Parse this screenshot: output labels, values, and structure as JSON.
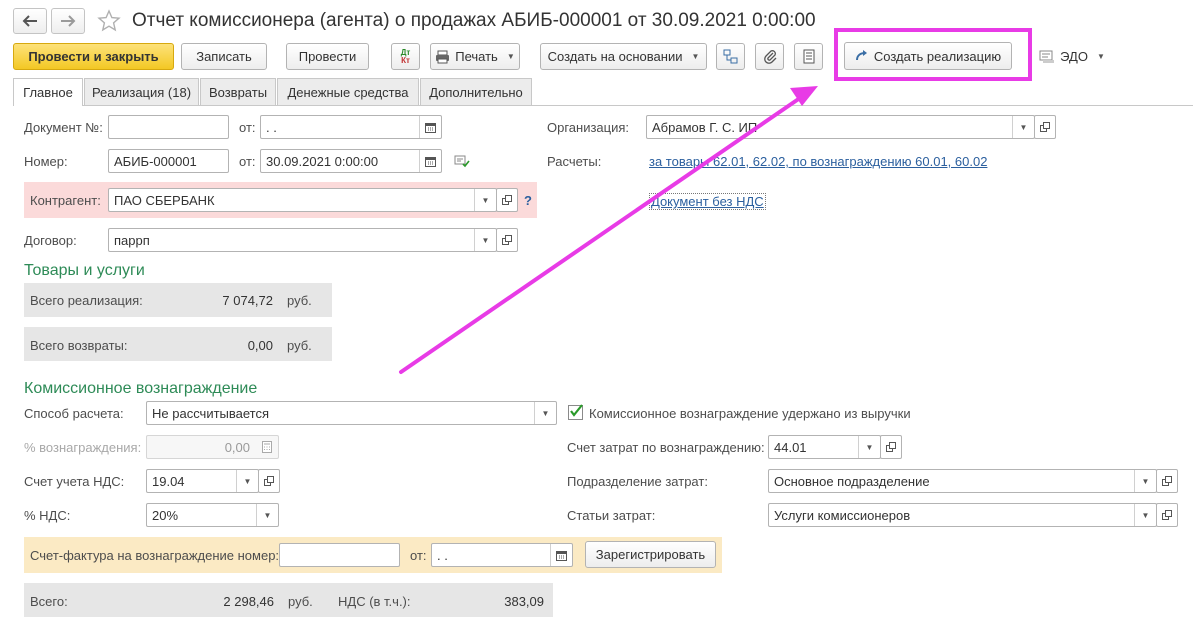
{
  "title": "Отчет комиссионера (агента) о продажах АБИБ-000001 от 30.09.2021 0:00:00",
  "toolbar": {
    "post_close": "Провести и закрыть",
    "save": "Записать",
    "post": "Провести",
    "print": "Печать",
    "create_based": "Создать на основании",
    "create_sale": "Создать реализацию",
    "edo": "ЭДО",
    "dtkt_top": "Дт",
    "dtkt_bottom": "Кт"
  },
  "tabs": [
    "Главное",
    "Реализация (18)",
    "Возвраты",
    "Денежные средства",
    "Дополнительно"
  ],
  "form": {
    "doc_no_label": "Документ №:",
    "doc_no_value": "",
    "from_label": "от:",
    "doc_date_value": " .  .",
    "number_label": "Номер:",
    "number_value": "АБИБ-000001",
    "number_date_value": "30.09.2021  0:00:00",
    "counterparty_label": "Контрагент:",
    "counterparty_value": "ПАО СБЕРБАНК",
    "help_mark": "?",
    "contract_label": "Договор:",
    "contract_value": "паррп",
    "org_label": "Организация:",
    "org_value": "Абрамов Г. С. ИП",
    "settlements_label": "Расчеты:",
    "settlements_link": "за товары 62.01, 62.02, по вознаграждению 60.01, 60.02",
    "vat_link": "Документ без НДС"
  },
  "goods": {
    "section_title": "Товары и услуги",
    "total_sales_label": "Всего реализация:",
    "total_sales_value": "7 074,72",
    "total_returns_label": "Всего возвраты:",
    "total_returns_value": "0,00",
    "currency": "руб."
  },
  "commission": {
    "section_title": "Комиссионное вознаграждение",
    "method_label": "Способ расчета:",
    "method_value": "Не рассчитывается",
    "withheld_label": "Комиссионное вознаграждение удержано из выручки",
    "withheld_checked": true,
    "percent_label": "% вознаграждения:",
    "percent_value": "0,00",
    "cost_account_label": "Счет затрат по вознаграждению:",
    "cost_account_value": "44.01",
    "vat_account_label": "Счет учета НДС:",
    "vat_account_value": "19.04",
    "dept_label": "Подразделение затрат:",
    "dept_value": "Основное подразделение",
    "vat_rate_label": "% НДС:",
    "vat_rate_value": "20%",
    "cost_items_label": "Статьи затрат:",
    "cost_items_value": "Услуги комиссионеров",
    "invoice_label": "Счет-фактура на вознаграждение номер:",
    "invoice_no_value": "",
    "invoice_from_label": "от:",
    "invoice_date_value": " .  .",
    "register_button": "Зарегистрировать",
    "total_label": "Всего:",
    "total_value": "2 298,46",
    "currency": "руб.",
    "vat_incl_label": "НДС (в т.ч.):",
    "vat_incl_value": "383,09"
  },
  "colors": {
    "accent_button": "#f7d23a",
    "highlight_frame": "#e83be6",
    "section_title": "#2e8b57",
    "counterparty_highlight": "#fbdada",
    "invoice_highlight": "#fbeac4",
    "totals_panel": "#e6e6e6",
    "link": "#2b5f9e"
  },
  "icons": [
    "back-arrow-icon",
    "forward-arrow-icon",
    "star-icon",
    "dtkt-icon",
    "printer-icon",
    "structure-icon",
    "paperclip-icon",
    "document-icon",
    "create-sale-arrow-icon",
    "edo-icon",
    "calendar-icon",
    "calculator-icon",
    "open-icon",
    "dropdown-icon",
    "checkbox-icon",
    "arrow-annotation"
  ]
}
